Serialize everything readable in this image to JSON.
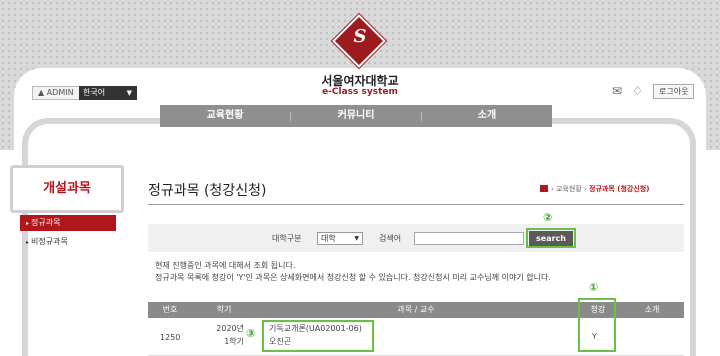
{
  "header": {
    "univ_name": "서울여자대학교",
    "univ_sub": "e-Class system",
    "logo_mark": "S",
    "admin_label": "ADMIN",
    "language": "한국어",
    "logout": "로그아웃",
    "icons": [
      "mail-icon",
      "bell-icon"
    ]
  },
  "nav": {
    "items": [
      "교육현황",
      "커뮤니티",
      "소개"
    ]
  },
  "sidebar": {
    "title": "개설과목",
    "items": [
      {
        "label": "정규과목",
        "active": true
      },
      {
        "label": "비정규과목",
        "active": false
      }
    ]
  },
  "page": {
    "title": "정규과목 (청강신청)",
    "breadcrumb": [
      "교육현황",
      "정규과목 (청강신청)"
    ]
  },
  "search": {
    "category_label": "대학구분",
    "category_value": "대학",
    "keyword_label": "검색어",
    "keyword_value": "",
    "button": "search"
  },
  "notice": [
    "현재 진행중인 과목에 대해서 조회 됩니다.",
    "정규과목 목록에 청강이 'Y'인 과목은 상세화면에서 청강신청 할 수 있습니다. 청강신청시 미리 교수님께 이야기 합니다."
  ],
  "table": {
    "columns": [
      "번호",
      "학기",
      "과목 / 교수",
      "청강",
      "소개"
    ],
    "rows": [
      {
        "no": "1250",
        "year": "2020년",
        "term": "1학기",
        "course": "기독교개론(UA02001-06)",
        "professor": "오진곤",
        "audit": "Y",
        "intro": ""
      }
    ]
  },
  "annotations": {
    "m1": "①",
    "m2": "②",
    "m3": "③",
    "color": "#6cc04a"
  },
  "colors": {
    "brand": "#9d1b1e",
    "sidebar_active": "#b0161c",
    "gnb": "#8f8f8f"
  }
}
